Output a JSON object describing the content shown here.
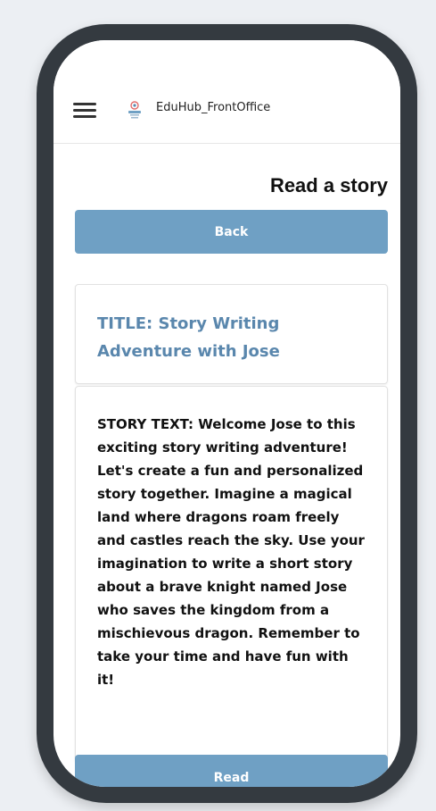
{
  "app": {
    "title": "EduHub_FrontOffice"
  },
  "page": {
    "heading": "Read a story"
  },
  "buttons": {
    "back": "Back",
    "read": "Read"
  },
  "story": {
    "title": "TITLE: Story Writing Adventure with Jose",
    "text": "STORY TEXT: Welcome Jose to this exciting story writing adventure! Let's create a fun and personalized story together. Imagine a magical land where dragons roam freely and castles reach the sky. Use your imagination to write a short story about a brave knight named Jose who saves the kingdom from a mischievous dragon. Remember to take your time and have fun with it!"
  },
  "colors": {
    "button": "#6fa0c4",
    "title_accent": "#5a87ad",
    "phone_frame": "#343a40"
  },
  "icons": {
    "menu": "hamburger-menu-icon",
    "logo": "app-logo-icon"
  }
}
